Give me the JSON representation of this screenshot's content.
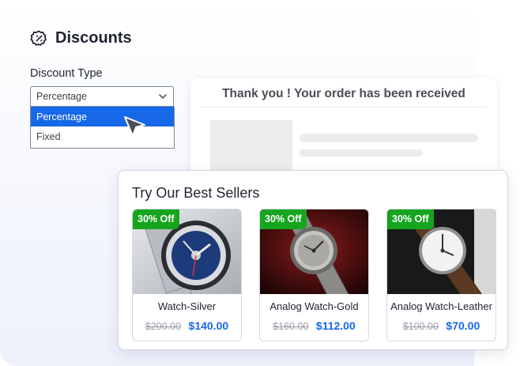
{
  "header": {
    "title": "Discounts",
    "icon": "percent-badge-icon"
  },
  "discount_type": {
    "label": "Discount Type",
    "selected": "Percentage",
    "options": [
      "Percentage",
      "Fixed"
    ]
  },
  "thank_you": {
    "title": "Thank you ! Your order has been received"
  },
  "best_sellers": {
    "title": "Try Our Best Sellers",
    "products": [
      {
        "badge": "30% Off",
        "name": "Watch-Silver",
        "old_price": "$200.00",
        "new_price": "$140.00"
      },
      {
        "badge": "30% Off",
        "name": "Analog Watch-Gold",
        "old_price": "$160.00",
        "new_price": "$112.00"
      },
      {
        "badge": "30% Off",
        "name": "Analog Watch-Leather",
        "old_price": "$100.00",
        "new_price": "$70.00"
      }
    ]
  },
  "colors": {
    "accent": "#1668e8",
    "badge": "#16a51f",
    "text": "#1f2330"
  }
}
